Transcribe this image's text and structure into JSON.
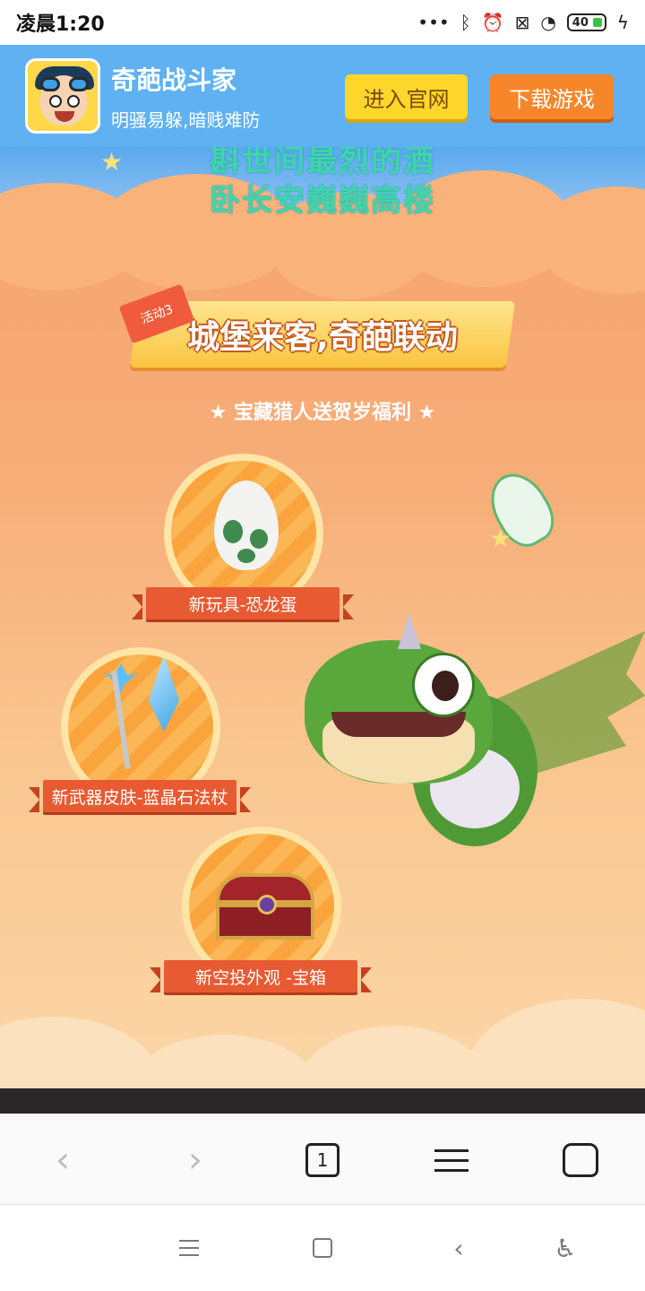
{
  "status_bar": {
    "time": "凌晨1:20",
    "battery": "40",
    "icons": [
      "more-dots-icon",
      "bluetooth-icon",
      "alarm-icon",
      "sim-off-icon",
      "wifi-icon",
      "battery-icon",
      "charging-icon"
    ]
  },
  "app_banner": {
    "name": "奇葩战斗家",
    "slogan": "明骚易躲,暗贱难防",
    "official_button": "进入官网",
    "download_button": "下载游戏",
    "colors": {
      "background": "#5fb1f2",
      "official": "#ffd72a",
      "download": "#f7862a"
    }
  },
  "poem": {
    "line1": "斟世间最烈的酒",
    "line2": "卧长安巍巍高楼"
  },
  "activity": {
    "tag": "活动3",
    "title": "城堡来客,奇葩联动",
    "subtitle": "★ 宝藏猎人送贺岁福利 ★"
  },
  "rewards": [
    {
      "label": "新玩具-恐龙蛋",
      "icon": "dinosaur-egg-icon"
    },
    {
      "label": "新武器皮肤-蓝晶石法杖",
      "icon": "crystal-staff-icon"
    },
    {
      "label": "新空投外观 -宝箱",
      "icon": "treasure-chest-icon"
    }
  ],
  "browser_toolbar": {
    "tab_count": "1",
    "back_glyph": "‹",
    "forward_glyph": "›"
  },
  "system_nav": {
    "back_glyph": "‹",
    "access_glyph": "♿"
  }
}
